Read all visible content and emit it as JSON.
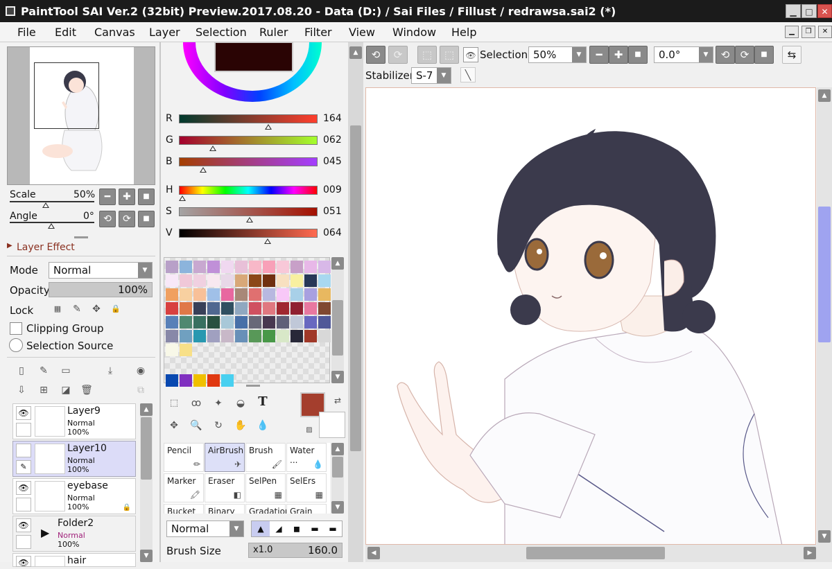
{
  "window": {
    "title": "PaintTool SAI Ver.2 (32bit) Preview.2017.08.20 - Data (D:) / Sai Files / Fillust / redrawsa.sai2 (*)"
  },
  "menu": [
    "File",
    "Edit",
    "Canvas",
    "Layer",
    "Selection",
    "Ruler",
    "Filter",
    "View",
    "Window",
    "Help"
  ],
  "navigator": {
    "scale_label": "Scale",
    "scale_value": "50%",
    "angle_label": "Angle",
    "angle_value": "0°",
    "scale_level": 0.5,
    "angle_level": 0.5
  },
  "layer_effect": {
    "header": "Layer Effect",
    "mode_label": "Mode",
    "mode_value": "Normal",
    "opacity_label": "Opacity",
    "opacity_value": "100%",
    "lock_label": "Lock",
    "clipping_label": "Clipping Group",
    "selection_source_label": "Selection Source"
  },
  "layers": [
    {
      "name": "Layer9",
      "mode": "Normal",
      "opacity": "100%",
      "visible": true,
      "selected": false
    },
    {
      "name": "Layer10",
      "mode": "Normal",
      "opacity": "100%",
      "visible": false,
      "selected": true
    },
    {
      "name": "eyebase",
      "mode": "Normal",
      "opacity": "100%",
      "visible": true,
      "selected": false
    },
    {
      "name": "Folder2",
      "mode": "Normal",
      "opacity": "100%",
      "visible": true,
      "selected": false
    },
    {
      "name": "hair",
      "mode": "",
      "opacity": "",
      "visible": true,
      "selected": false
    }
  ],
  "color": {
    "R": {
      "label": "R",
      "value": "164",
      "level": 0.643
    },
    "G": {
      "label": "G",
      "value": "062",
      "level": 0.243
    },
    "B": {
      "label": "B",
      "value": "045",
      "level": 0.176
    },
    "H": {
      "label": "H",
      "value": "009",
      "level": 0.025
    },
    "S": {
      "label": "S",
      "value": "051",
      "level": 0.51
    },
    "V": {
      "label": "V",
      "value": "064",
      "level": 0.64
    },
    "current": "#a43e2d"
  },
  "swatches": [
    "#b8a0c8",
    "#8cb4dc",
    "#c8a8d0",
    "#c090d8",
    "#f0d8f0",
    "#e8c0d8",
    "#f8b8c8",
    "#f8a0b8",
    "#f8c8d8",
    "#c8a0c8",
    "#e8b8e8",
    "#d8b8e8",
    "#f8e8f8",
    "#f0c8d8",
    "#f0d0e0",
    "#f8e8f0",
    "#e8d8e8",
    "#d8a878",
    "#8c4818",
    "#703010",
    "#f8e0c0",
    "#f8f0a0",
    "#283858",
    "#a8d8f0",
    "#f0a060",
    "#f8d0a0",
    "#f8c098",
    "#a0c0e8",
    "#e868a0",
    "#a88878",
    "#e07070",
    "#b8b8e0",
    "#f8c8f8",
    "#a8d0e8",
    "#a8a0e0",
    "#e8b860",
    "#d84040",
    "#e07848",
    "#384058",
    "#506890",
    "#305060",
    "#90a8c0",
    "#d05060",
    "#e07880",
    "#a02830",
    "#902030",
    "#e878a0",
    "#804830",
    "#5880b8",
    "#508870",
    "#387060",
    "#285040",
    "#a8c8d8",
    "#4870a8",
    "#686878",
    "#483850",
    "#606078",
    "#c0c8d8",
    "#6868c0",
    "#505898",
    "#8888a8",
    "#70a0c0",
    "#2898b0",
    "#a0a0c0",
    "#c8b8c8",
    "#6890b8",
    "#589858",
    "#489848",
    "#d8e8c8",
    "#282838",
    "#a03828",
    "#d8d8d8",
    "#f8f8e8",
    "#f8e088",
    "#0848b0",
    "#8030c0",
    "#f0c000",
    "#e03810",
    "#48d0f0"
  ],
  "tools": [
    {
      "name": "Pencil",
      "selected": false
    },
    {
      "name": "AirBrush",
      "selected": true
    },
    {
      "name": "Brush",
      "selected": false
    },
    {
      "name": "Water ...",
      "selected": false
    },
    {
      "name": "Marker",
      "selected": false
    },
    {
      "name": "Eraser",
      "selected": false
    },
    {
      "name": "SelPen",
      "selected": false
    },
    {
      "name": "SelErs",
      "selected": false
    },
    {
      "name": "Bucket",
      "selected": false
    },
    {
      "name": "Binary",
      "selected": false
    },
    {
      "name": "Gradation",
      "selected": false
    },
    {
      "name": "Grain",
      "selected": false
    }
  ],
  "brush": {
    "blend_mode": "Normal",
    "size_label": "Brush Size",
    "size_multiplier": "x1.0",
    "size_value": "160.0"
  },
  "toolbar": {
    "selection_label": "Selection",
    "zoom_value": "50%",
    "rotation_value": "0.0°",
    "stabilizer_label": "Stabilizer",
    "stabilizer_value": "S-7"
  },
  "colors": {
    "accent": "#a43e2d",
    "selected_layer": "#dcdcf8",
    "scroll_thumb": "#9fa3f0"
  }
}
